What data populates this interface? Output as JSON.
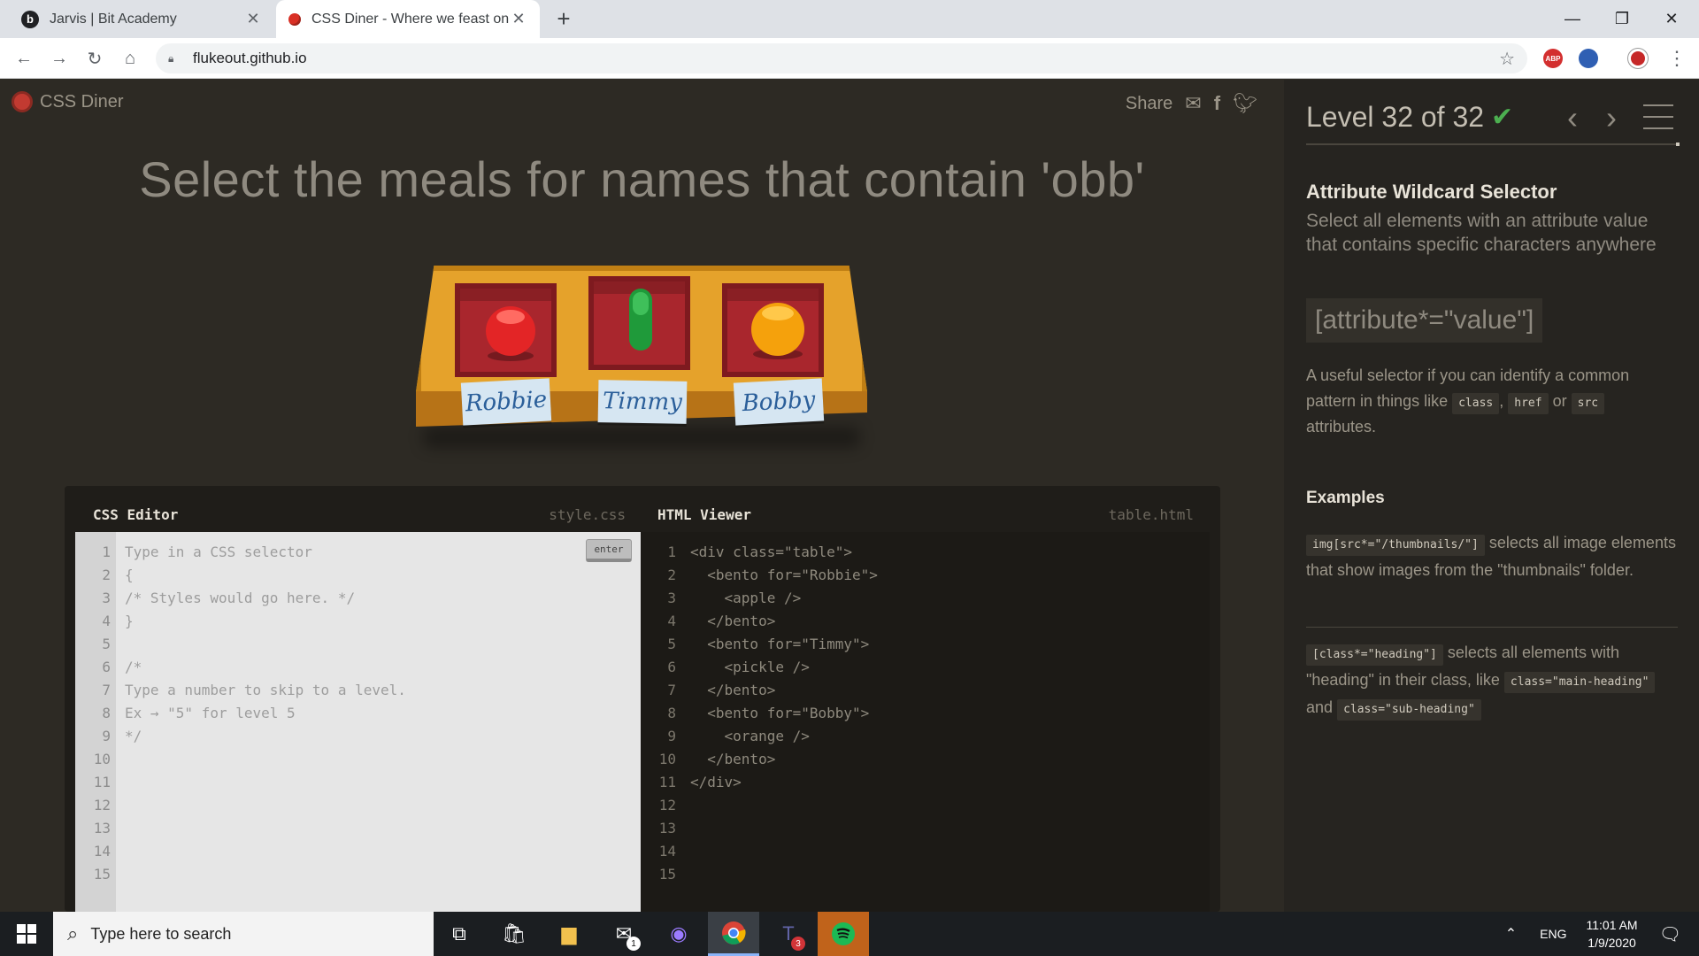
{
  "browser": {
    "tabs": [
      {
        "title": "Jarvis | Bit Academy",
        "active": false
      },
      {
        "title": "CSS Diner - Where we feast on C",
        "active": true
      }
    ],
    "new_tab": "+",
    "url": "flukeout.github.io",
    "window_controls": {
      "minimize": "—",
      "maximize": "❐",
      "close": "✕"
    },
    "extensions": [
      {
        "name": "adblock-plus-icon",
        "label": "ABP",
        "color": "#d32f2f"
      },
      {
        "name": "extension-icon",
        "label": "",
        "color": "#2f5fb3"
      },
      {
        "name": "profile-avatar-icon",
        "label": "",
        "color": "#c62828"
      }
    ]
  },
  "app": {
    "logo": "CSS Diner",
    "share_label": "Share",
    "instructions": "Select the meals for names that contain 'obb'",
    "table": {
      "bentos": [
        {
          "name": "Robbie",
          "food": "apple",
          "color": "#e32526"
        },
        {
          "name": "Timmy",
          "food": "pickle",
          "color": "#1f9a3a"
        },
        {
          "name": "Bobby",
          "food": "orange",
          "color": "#f5a10c"
        }
      ]
    },
    "css_editor": {
      "title": "CSS Editor",
      "file": "style.css",
      "enter_label": "enter",
      "line_numbers": [
        "1",
        "2",
        "3",
        "4",
        "5",
        "6",
        "7",
        "8",
        "9",
        "10",
        "11",
        "12",
        "13",
        "14",
        "15"
      ],
      "code": "Type in a CSS selector\n{\n/* Styles would go here. */\n}\n\n/*\nType a number to skip to a level.\nEx → \"5\" for level 5\n*/"
    },
    "html_viewer": {
      "title": "HTML Viewer",
      "file": "table.html",
      "line_numbers": [
        "1",
        "2",
        "3",
        "4",
        "5",
        "6",
        "7",
        "8",
        "9",
        "10",
        "11",
        "12",
        "13",
        "14",
        "15"
      ],
      "code": "<div class=\"table\">\n  <bento for=\"Robbie\">\n    <apple />\n  </bento>\n  <bento for=\"Timmy\">\n    <pickle />\n  </bento>\n  <bento for=\"Bobby\">\n    <orange />\n  </bento>\n</div>"
    }
  },
  "sidebar": {
    "level_label": "Level 32 of 32",
    "level_current": 32,
    "level_total": 32,
    "selector_name": "Attribute Wildcard Selector",
    "description": "Select all elements with an attribute value that contains specific characters anywhere",
    "syntax": "[attribute*=\"value\"]",
    "hint_prefix": "A useful selector if you can identify a common pattern in things like",
    "hint_chip1": "class",
    "hint_chip2": "href",
    "hint_or": "or",
    "hint_chip3": "src",
    "hint_suffix": "attributes.",
    "examples_title": "Examples",
    "example1_code": "img[src*=\"/thumbnails/\"]",
    "example1_text": "selects all image elements that show images from the \"thumbnails\" folder.",
    "example2_code": "[class*=\"heading\"]",
    "example2_text": "selects all elements with \"heading\" in their class, like",
    "example2_code2": "class=\"main-heading\"",
    "example2_and": "and",
    "example2_code3": "class=\"sub-heading\""
  },
  "taskbar": {
    "search_placeholder": "Type here to search",
    "mail_badge": "1",
    "teams_badge": "3",
    "language": "ENG",
    "time": "11:01 AM",
    "date": "1/9/2020"
  }
}
